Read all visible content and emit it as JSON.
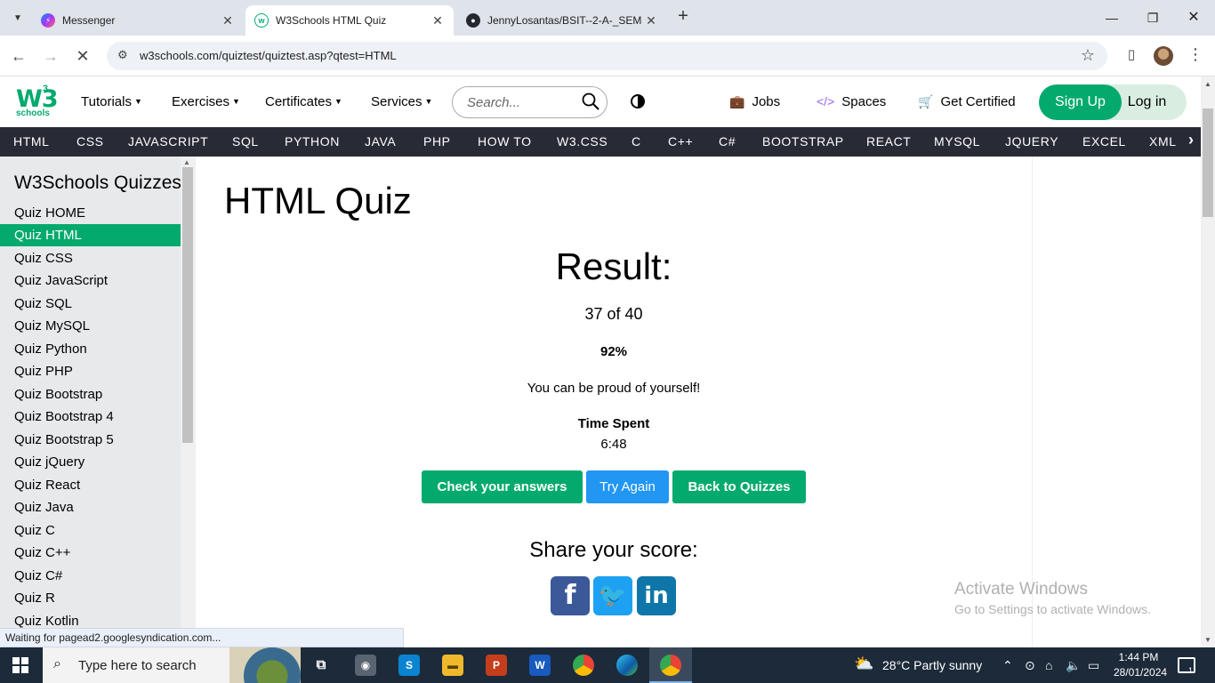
{
  "browser": {
    "tabs": [
      {
        "title": "Messenger",
        "active": false,
        "favicon": "messenger-icon"
      },
      {
        "title": "W3Schools HTML Quiz",
        "active": true,
        "favicon": "w3schools-icon"
      },
      {
        "title": "JennyLosantas/BSIT--2-A-_SEM",
        "active": false,
        "favicon": "github-icon"
      }
    ],
    "url": "w3schools.com/quiztest/quiztest.asp?qtest=HTML"
  },
  "header": {
    "logo_main": "W3",
    "logo_sup": "3",
    "logo_sub": "schools",
    "menu": [
      "Tutorials",
      "Exercises",
      "Certificates",
      "Services"
    ],
    "search_placeholder": "Search...",
    "jobs": "Jobs",
    "spaces": "Spaces",
    "get_certified": "Get Certified",
    "signup": "Sign Up",
    "login": "Log in"
  },
  "topnav": [
    "HTML",
    "CSS",
    "JAVASCRIPT",
    "SQL",
    "PYTHON",
    "JAVA",
    "PHP",
    "HOW TO",
    "W3.CSS",
    "C",
    "C++",
    "C#",
    "BOOTSTRAP",
    "REACT",
    "MYSQL",
    "JQUERY",
    "EXCEL",
    "XML"
  ],
  "sidebar": {
    "heading": "W3Schools Quizzes",
    "items": [
      "Quiz HOME",
      "Quiz HTML",
      "Quiz CSS",
      "Quiz JavaScript",
      "Quiz SQL",
      "Quiz MySQL",
      "Quiz Python",
      "Quiz PHP",
      "Quiz Bootstrap",
      "Quiz Bootstrap 4",
      "Quiz Bootstrap 5",
      "Quiz jQuery",
      "Quiz React",
      "Quiz Java",
      "Quiz C",
      "Quiz C++",
      "Quiz C#",
      "Quiz R",
      "Quiz Kotlin"
    ],
    "active_index": 1
  },
  "main": {
    "title": "HTML Quiz",
    "result_title": "Result:",
    "score": "37 of 40",
    "percent": "92%",
    "message": "You can be proud of yourself!",
    "time_label": "Time Spent",
    "time_value": "6:48",
    "buttons": {
      "check": "Check your answers",
      "try_again": "Try Again",
      "back": "Back to Quizzes"
    },
    "share_label": "Share your score:",
    "social": [
      "facebook-icon",
      "twitter-icon",
      "linkedin-icon"
    ]
  },
  "watermark": {
    "line1": "Activate Windows",
    "line2": "Go to Settings to activate Windows."
  },
  "status_text": "Waiting for pagead2.googlesyndication.com...",
  "taskbar": {
    "search_placeholder": "Type here to search",
    "weather": "28°C  Partly sunny",
    "time": "1:44 PM",
    "date": "28/01/2024",
    "notification_count": "1"
  },
  "colors": {
    "w3_green": "#04aa6d",
    "topnav_bg": "#282a35",
    "sidebar_bg": "#e7e9eb",
    "try_again_blue": "#2196f3",
    "facebook": "#3b5998",
    "twitter": "#1da1f2",
    "linkedin": "#0e76a8"
  }
}
